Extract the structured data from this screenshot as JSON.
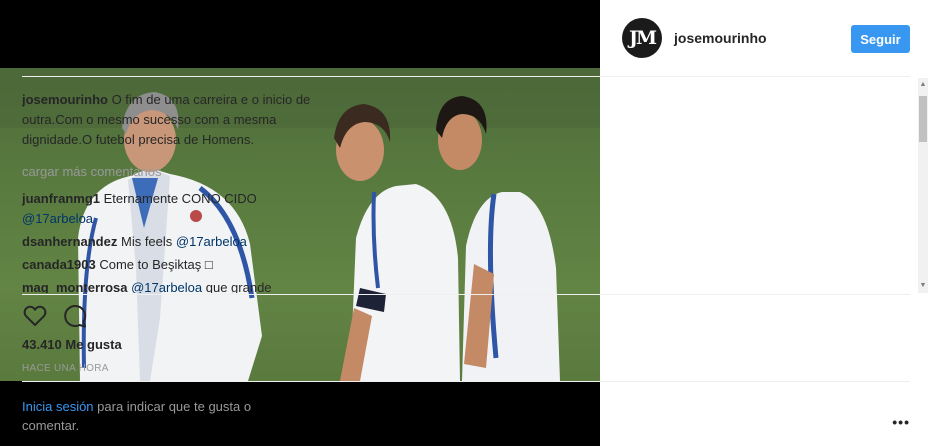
{
  "post": {
    "username": "josemourinho",
    "avatar_text": "JM",
    "follow_label": "Seguir",
    "caption": "O fim de uma carreira e o inicio de outra.Com o mesmo sucesso com a mesma dignidade.O futebol precisa de Homens.",
    "load_more": "cargar más comentarios",
    "comments": [
      {
        "user": "juanfranmg1",
        "text": "Eternamente CONO CIDO ",
        "mention": "@17arbeloa"
      },
      {
        "user": "dsanhernandez",
        "text": "Mis feels ",
        "mention": "@17arbeloa"
      },
      {
        "user": "canada1903",
        "text": "Come to Beşiktaş □",
        "mention": ""
      },
      {
        "user": "mag_monterrosa",
        "text": "",
        "mention": "@17arbeloa",
        "tail": " que grande"
      }
    ],
    "likes": "43.410 Me gusta",
    "time": "HACE UNA HORA",
    "login_link": "Inicia sesión",
    "login_text": " para indicar que te gusta o comentar.",
    "more_options": "•••"
  },
  "icons": [
    "heart-icon",
    "comment-icon",
    "more-options-icon",
    "scroll-up-icon",
    "scroll-down-icon"
  ],
  "colors": {
    "accent": "#3897f0",
    "text": "#262626",
    "muted": "#999999",
    "mention": "#003569"
  }
}
